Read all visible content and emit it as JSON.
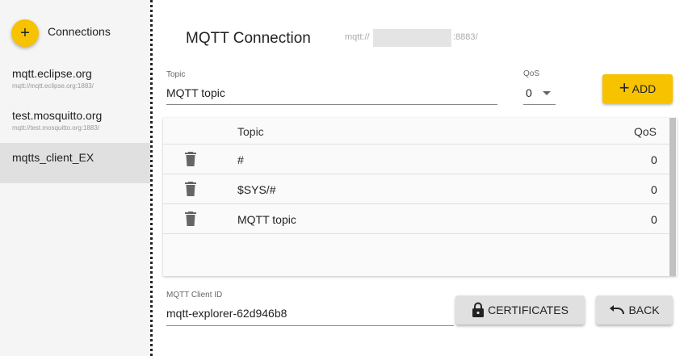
{
  "sidebar": {
    "add_icon": "+",
    "title": "Connections",
    "items": [
      {
        "name": "mqtt.eclipse.org",
        "url": "mqtt://mqtt.eclipse.org:1883/"
      },
      {
        "name": "test.mosquitto.org",
        "url": "mqtt://test.mosquitto.org:1883/"
      },
      {
        "name": "mqtts_client_EX",
        "url": ""
      }
    ]
  },
  "main": {
    "title": "MQTT Connection",
    "url_prefix": "mqtt://",
    "url_port": ":8883/"
  },
  "subscribe": {
    "topic_label": "Topic",
    "topic_value": "MQTT topic",
    "qos_label": "QoS",
    "qos_value": "0",
    "add_label": "ADD"
  },
  "table": {
    "headers": {
      "topic": "Topic",
      "qos": "QoS"
    },
    "rows": [
      {
        "topic": "#",
        "qos": "0"
      },
      {
        "topic": "$SYS/#",
        "qos": "0"
      },
      {
        "topic": "MQTT topic",
        "qos": "0"
      }
    ]
  },
  "client": {
    "label": "MQTT Client ID",
    "value": "mqtt-explorer-62d946b8"
  },
  "buttons": {
    "certificates": "CERTIFICATES",
    "back": "BACK"
  }
}
